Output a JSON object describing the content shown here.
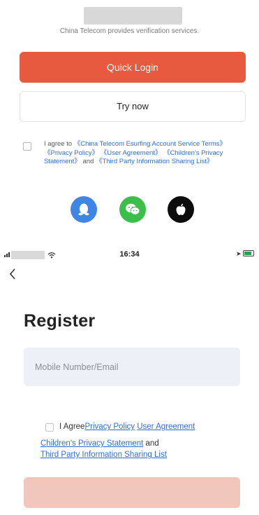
{
  "quick_login_screen": {
    "provider_note": "China Telecom provides verification services.",
    "quick_login_label": "Quick Login",
    "try_now_label": "Try now",
    "agreement": {
      "prefix": "I agree to",
      "telecom_terms": "《China Telecom Esurfing Account Service Terms》",
      "privacy_policy": "《Privacy Policy》",
      "user_agreement": "《User Agreement》",
      "childrens_privacy": "《Children's Privacy Statement》",
      "and": "and",
      "third_party": "《Third Party Information Sharing List》"
    },
    "social_icons": [
      "qq-icon",
      "wechat-icon",
      "apple-icon"
    ]
  },
  "status_bar": {
    "time": "16:34"
  },
  "register_screen": {
    "title": "Register",
    "mobile_placeholder": "Mobile Number/Email",
    "agreement": {
      "i_agree": "I Agree",
      "privacy_policy": "Privacy Policy",
      "user_agreement": "User Agreement",
      "childrens_privacy": "Children's Privacy Statement",
      "and": "and",
      "third_party": "Third Party Information Sharing List"
    }
  },
  "colors": {
    "accent": "#e85a3f",
    "accent_disabled": "#f1c7bd",
    "link": "#2f6fd6",
    "input_bg": "#eef0f7",
    "qq": "#3e86e6",
    "wechat": "#3cbf4a",
    "apple": "#0d0d0d"
  }
}
